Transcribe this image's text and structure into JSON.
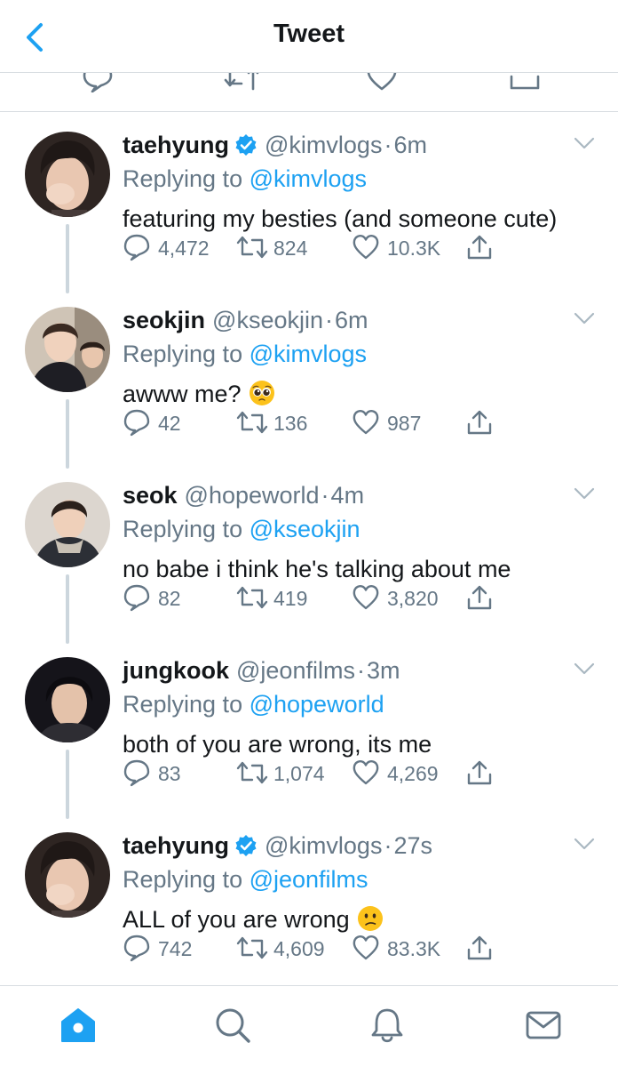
{
  "header": {
    "title": "Tweet",
    "back_icon": "chevron-left-icon"
  },
  "colors": {
    "accent": "#1da1f2",
    "text": "#14171a",
    "muted": "#657786",
    "divider": "#d8dde1",
    "thread_line": "#ccd6dd"
  },
  "tweets": [
    {
      "name": "taehyung",
      "verified": true,
      "handle": "@kimvlogs",
      "dot": "·",
      "time": "6m",
      "replying_prefix": "Replying to ",
      "replying_to": "@kimvlogs",
      "text": "featuring my besties (and someone cute)",
      "emoji": "",
      "replies": "4,472",
      "retweets": "824",
      "likes": "10.3K"
    },
    {
      "name": "seokjin",
      "verified": false,
      "handle": "@kseokjin",
      "dot": "·",
      "time": "6m",
      "replying_prefix": "Replying to ",
      "replying_to": "@kimvlogs",
      "text": "awww me?",
      "emoji": "pleading-face-emoji",
      "replies": "42",
      "retweets": "136",
      "likes": "987"
    },
    {
      "name": "seok",
      "verified": false,
      "handle": "@hopeworld",
      "dot": "·",
      "time": "4m",
      "replying_prefix": "Replying to ",
      "replying_to": "@kseokjin",
      "text": "no babe i think he's talking about me",
      "emoji": "",
      "replies": "82",
      "retweets": "419",
      "likes": "3,820"
    },
    {
      "name": "jungkook",
      "verified": false,
      "handle": "@jeonfilms",
      "dot": "·",
      "time": "3m",
      "replying_prefix": "Replying to ",
      "replying_to": "@hopeworld",
      "text": "both of you are wrong, its me",
      "emoji": "",
      "replies": "83",
      "retweets": "1,074",
      "likes": "4,269"
    },
    {
      "name": "taehyung",
      "verified": true,
      "handle": "@kimvlogs",
      "dot": "·",
      "time": "27s",
      "replying_prefix": "Replying to ",
      "replying_to": "@jeonfilms",
      "text": "ALL of you are wrong",
      "emoji": "confused-face-emoji",
      "replies": "742",
      "retweets": "4,609",
      "likes": "83.3K"
    }
  ],
  "tabbar": {
    "items": [
      "home-icon",
      "search-icon",
      "notifications-icon",
      "messages-icon"
    ],
    "active": "home-icon"
  }
}
